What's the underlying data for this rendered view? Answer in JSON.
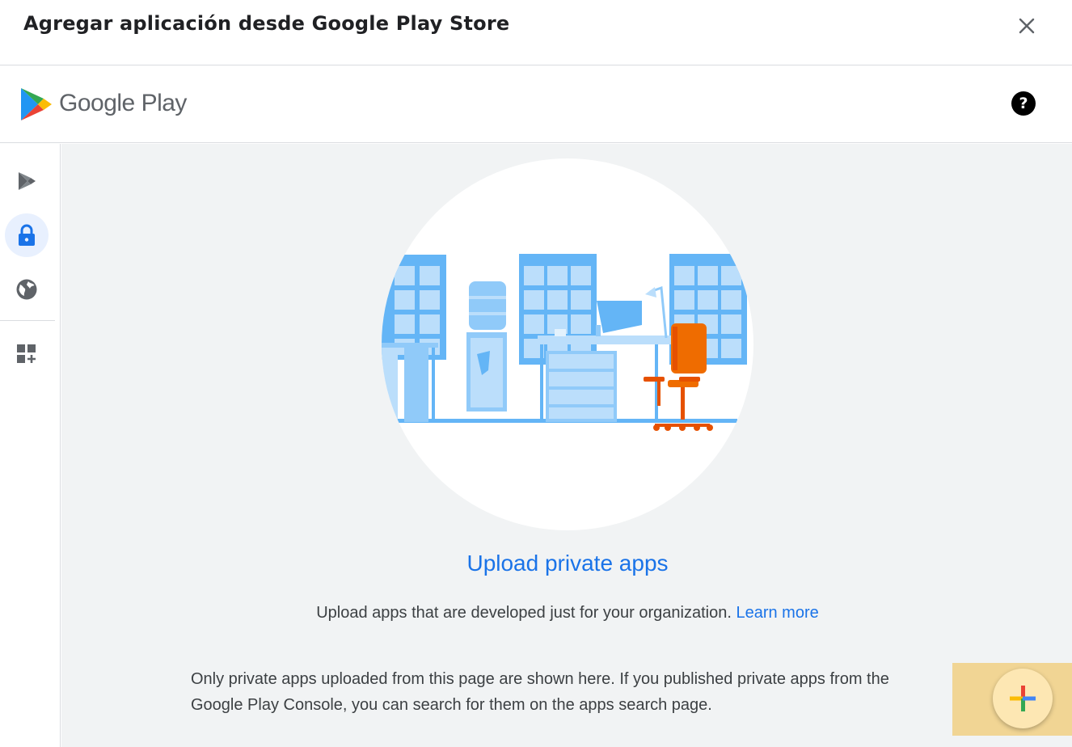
{
  "dialog": {
    "title": "Agregar aplicación desde Google Play Store",
    "close_icon": "close-icon"
  },
  "play_header": {
    "wordmark": "Google Play",
    "help_icon": "?"
  },
  "sidebar": {
    "items": [
      {
        "name": "managed-play-icon",
        "active": false
      },
      {
        "name": "lock-icon",
        "active": true
      },
      {
        "name": "globe-icon",
        "active": false
      },
      {
        "name": "add-widget-icon",
        "active": false
      }
    ]
  },
  "main": {
    "title": "Upload private apps",
    "description": "Upload apps that are developed just for your organization.",
    "learn_more": "Learn more",
    "note": "Only private apps uploaded from this page are shown here. If you published private apps from the Google Play Console, you can search for them on the apps search page."
  },
  "fab": {
    "icon": "plus-icon"
  },
  "colors": {
    "accent": "#1a73e8",
    "main_bg": "#f1f3f4",
    "fab_bg": "#fde7b3",
    "chair": "#ef6c00"
  }
}
